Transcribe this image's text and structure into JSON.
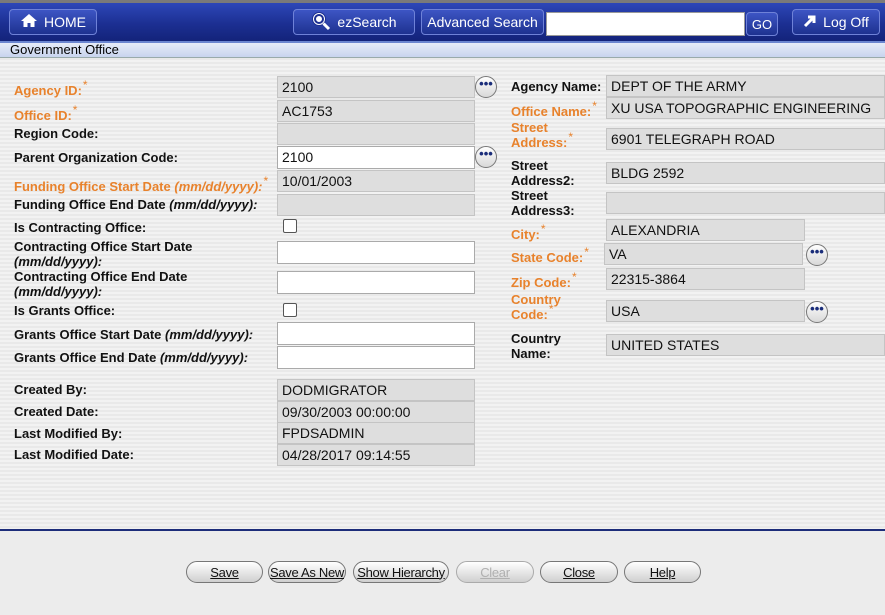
{
  "nav": {
    "home_label": "HOME",
    "ezsearch_label": "ezSearch",
    "advanced_search_label": "Advanced Search",
    "search_value": "",
    "go_label": "GO",
    "logoff_label": "Log Off"
  },
  "page_title": "Government Office",
  "left": {
    "agency_id": {
      "label": "Agency ID:",
      "value": "2100"
    },
    "office_id": {
      "label": "Office ID:",
      "value": "AC1753"
    },
    "region_code": {
      "label": "Region Code:",
      "value": ""
    },
    "parent_org": {
      "label": "Parent Organization Code:",
      "value": "2100"
    },
    "funding_start": {
      "label": "Funding Office Start Date",
      "fmt": "(mm/dd/yyyy):",
      "value": "10/01/2003"
    },
    "funding_end": {
      "label": "Funding Office End Date",
      "fmt": "(mm/dd/yyyy):",
      "value": ""
    },
    "is_contracting": {
      "label": "Is Contracting Office:"
    },
    "contracting_start": {
      "label": "Contracting Office Start Date",
      "fmt": "(mm/dd/yyyy):",
      "value": ""
    },
    "contracting_end": {
      "label": "Contracting Office End Date",
      "fmt": "(mm/dd/yyyy):",
      "value": ""
    },
    "is_grants": {
      "label": "Is Grants Office:"
    },
    "grants_start": {
      "label": "Grants Office Start Date",
      "fmt": "(mm/dd/yyyy):",
      "value": ""
    },
    "grants_end": {
      "label": "Grants Office End Date",
      "fmt": "(mm/dd/yyyy):",
      "value": ""
    },
    "created_by": {
      "label": "Created By:",
      "value": "DODMIGRATOR"
    },
    "created_date": {
      "label": "Created Date:",
      "value": "09/30/2003 00:00:00"
    },
    "last_modified_by": {
      "label": "Last Modified By:",
      "value": "FPDSADMIN"
    },
    "last_modified_date": {
      "label": "Last Modified Date:",
      "value": "04/28/2017 09:14:55"
    }
  },
  "right": {
    "agency_name": {
      "label": "Agency Name:",
      "value": "DEPT OF THE ARMY"
    },
    "office_name": {
      "label": "Office Name:",
      "value": "XU USA TOPOGRAPHIC ENGINEERING"
    },
    "street": {
      "label1": "Street",
      "label2": "Address:",
      "value": "6901 TELEGRAPH ROAD"
    },
    "street2": {
      "label1": "Street",
      "label2": "Address2:",
      "value": "BLDG 2592"
    },
    "street3": {
      "label1": "Street",
      "label2": "Address3:",
      "value": ""
    },
    "city": {
      "label": "City:",
      "value": "ALEXANDRIA"
    },
    "state": {
      "label": "State Code:",
      "value": "VA"
    },
    "zip": {
      "label": "Zip Code:",
      "value": "22315-3864"
    },
    "country_code": {
      "label1": "Country",
      "label2": "Code:",
      "value": "USA"
    },
    "country_name": {
      "label1": "Country",
      "label2": "Name:",
      "value": "UNITED STATES"
    }
  },
  "lookup_glyph": "•••",
  "required_mark": "*",
  "buttons": {
    "save": "Save",
    "save_as_new": "Save As New",
    "show_hierarchy": "Show Hierarchy",
    "clear": "Clear",
    "close": "Close",
    "help": "Help"
  },
  "icons": {
    "home": "house-icon",
    "ezsearch": "magnifier-icon",
    "logoff": "arrow-up-right-icon"
  }
}
